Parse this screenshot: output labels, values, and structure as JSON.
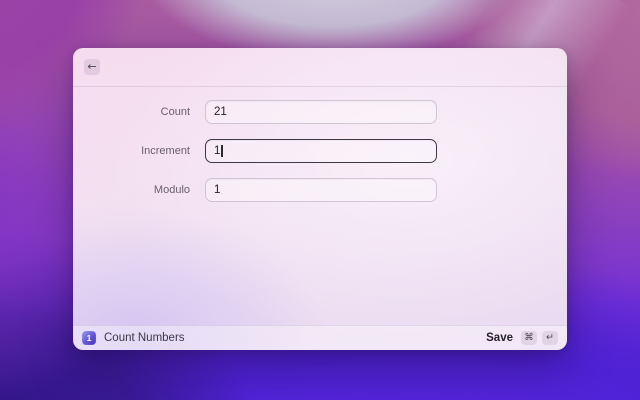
{
  "window": {
    "header": {
      "back_icon": "←"
    },
    "form": {
      "fields": [
        {
          "label": "Count",
          "value": "21",
          "focused": false
        },
        {
          "label": "Increment",
          "value": "1",
          "focused": true
        },
        {
          "label": "Modulo",
          "value": "1",
          "focused": false
        }
      ]
    },
    "footer": {
      "app_icon_label": "1",
      "title": "Count Numbers",
      "action_label": "Save",
      "shortcut_keys": [
        "⌘",
        "↵"
      ]
    }
  },
  "colors": {
    "accent_window_bg": "#f2e0f1",
    "focused_border": "#3d3944",
    "app_icon_gradient_start": "#93a0f0",
    "app_icon_gradient_end": "#4430bc",
    "wallpaper_top": "#a85b9f",
    "wallpaper_bottom": "#4e22cc"
  }
}
